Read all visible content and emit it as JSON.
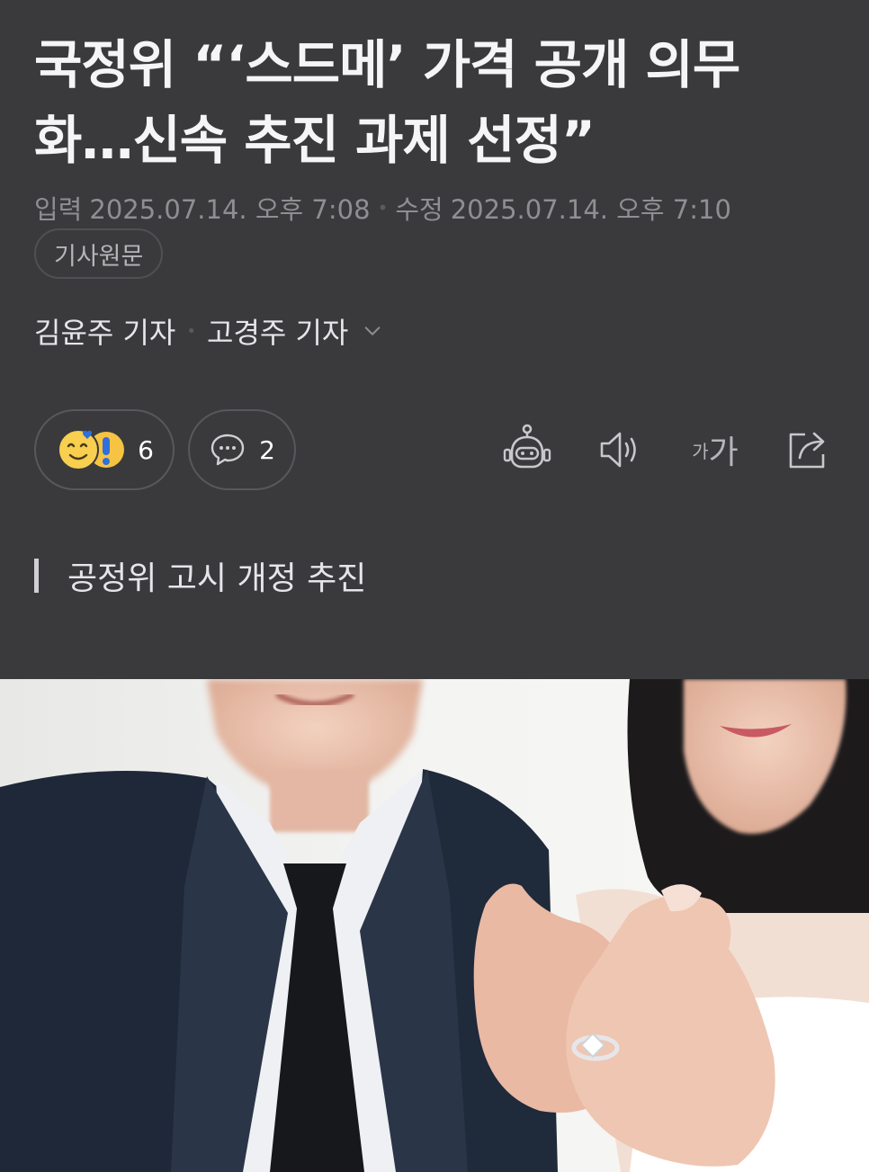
{
  "article": {
    "headline": "국정위 “‘스드메’ 가격 공개 의무화…신속 추진 과제 선정”",
    "dates": {
      "input_label": "입력",
      "input_value": "2025.07.14. 오후 7:08",
      "modified_label": "수정",
      "modified_value": "2025.07.14. 오후 7:10"
    },
    "original_button": "기사원문",
    "reporters": [
      "김윤주 기자",
      "고경주 기자"
    ],
    "reactions": {
      "count": "6"
    },
    "comments": {
      "count": "2"
    },
    "toolbar": {
      "robot_icon": "robot-icon",
      "speaker_icon": "speaker-icon",
      "font_small": "가",
      "font_big": "가",
      "share_icon": "share-icon"
    },
    "subheading": "공정위 고시 개정 추진"
  },
  "colors": {
    "background": "#3a3a3c",
    "headline": "#f5f5f7",
    "meta": "#8e8e93",
    "border": "#58585c"
  }
}
